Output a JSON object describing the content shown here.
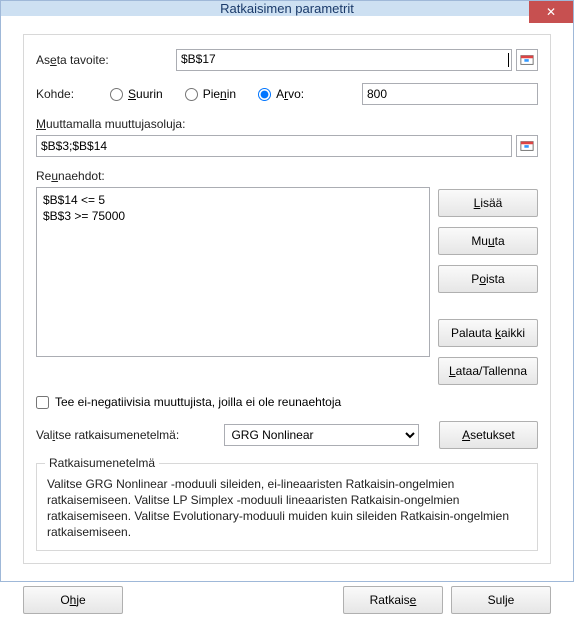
{
  "title": "Ratkaisimen parametrit",
  "close_symbol": "✕",
  "objective": {
    "label_pre": "As",
    "label_u": "e",
    "label_post": "ta tavoite:",
    "value": "$B$17"
  },
  "target": {
    "label": "Kohde:",
    "options": {
      "max_pre": "",
      "max_u": "S",
      "max_post": "uurin",
      "min_pre": "Pie",
      "min_u": "n",
      "min_post": "in",
      "val_pre": "A",
      "val_u": "r",
      "val_post": "vo:"
    },
    "value_input": "800"
  },
  "vars": {
    "label_pre": "",
    "label_u": "M",
    "label_post": "uuttamalla muuttujasoluja:",
    "value": "$B$3;$B$14"
  },
  "constraints": {
    "label_pre": "Re",
    "label_u": "u",
    "label_post": "naehdot:",
    "lines": [
      "$B$14 <= 5",
      "$B$3 >= 75000"
    ],
    "buttons": {
      "add_u": "L",
      "add_post": "isää",
      "change_pre": "Mu",
      "change_u": "u",
      "change_post": "ta",
      "delete_pre": "P",
      "delete_u": "o",
      "delete_post": "ista",
      "reset_pre": "Palauta ",
      "reset_u": "k",
      "reset_post": "aikki",
      "loadsave_u": "L",
      "loadsave_post": "ataa/Tallenna"
    }
  },
  "checkbox": {
    "pre": "Tee ei-negatiivisia muuttujista, joilla ei ole reunaehtoja",
    "checked": false
  },
  "method": {
    "label_pre": "Val",
    "label_u": "i",
    "label_post": "tse ratkaisumenetelmä:",
    "selected": "GRG Nonlinear",
    "options_btn_pre": "",
    "options_btn_u": "A",
    "options_btn_post": "setukset"
  },
  "group": {
    "title": "Ratkaisumenetelmä",
    "text": "Valitse GRG Nonlinear -moduuli sileiden, ei-lineaaristen Ratkaisin-ongelmien ratkaisemiseen. Valitse LP Simplex -moduuli lineaaristen Ratkaisin-ongelmien ratkaisemiseen. Valitse Evolutionary-moduuli muiden kuin sileiden Ratkaisin-ongelmien ratkaisemiseen."
  },
  "bottom": {
    "help_pre": "O",
    "help_u": "h",
    "help_post": "je",
    "solve_pre": "Ratkais",
    "solve_u": "e",
    "close": "Sulje"
  }
}
